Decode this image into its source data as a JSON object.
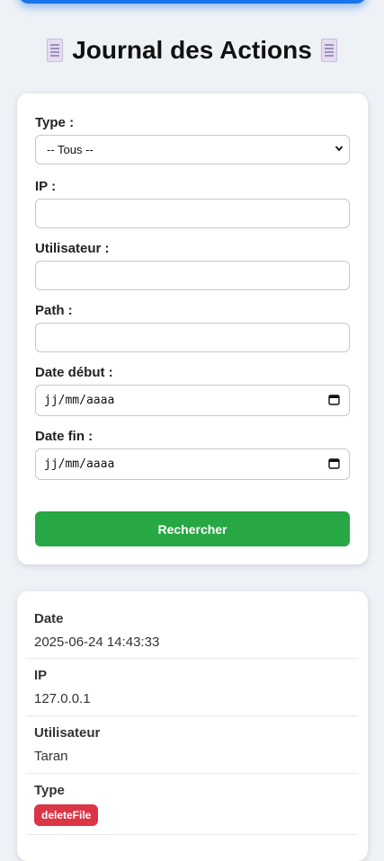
{
  "header": {
    "title": "Journal des Actions",
    "icon": "scroll-icon"
  },
  "filters": {
    "type_label": "Type :",
    "type_selected": "-- Tous --",
    "ip_label": "IP :",
    "ip_value": "",
    "user_label": "Utilisateur :",
    "user_value": "",
    "path_label": "Path :",
    "path_value": "",
    "date_start_label": "Date début :",
    "date_start_placeholder": "jj/mm/aaaa",
    "date_end_label": "Date fin :",
    "date_end_placeholder": "jj/mm/aaaa",
    "search_label": "Rechercher"
  },
  "result": {
    "date_label": "Date",
    "date_value": "2025-06-24 14:43:33",
    "ip_label": "IP",
    "ip_value": "127.0.0.1",
    "user_label": "Utilisateur",
    "user_value": "Taran",
    "type_label": "Type",
    "type_value": "deleteFile"
  },
  "colors": {
    "accent": "#1a73e8",
    "search_button": "#28a745",
    "type_badge": "#dc3545",
    "background": "#eef2f7"
  }
}
